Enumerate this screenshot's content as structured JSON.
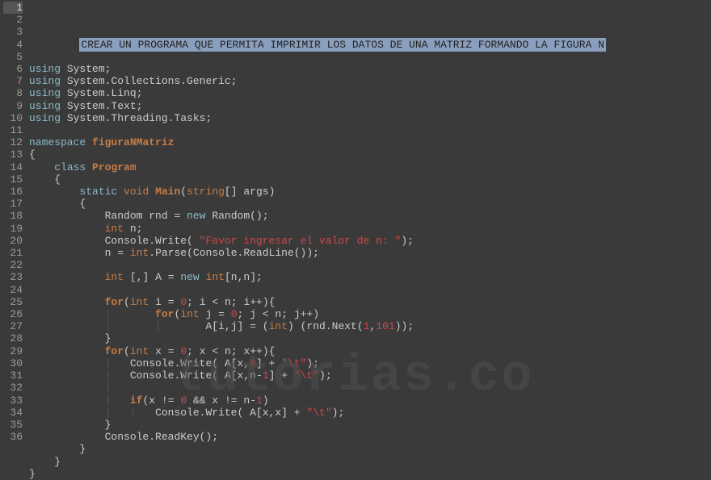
{
  "watermark": "tutorias.co",
  "lines": [
    {
      "n": 1,
      "current": true,
      "html": "        <span class='sel' data-name='selected-text' data-interactable='false'>CREAR UN PROGRAMA QUE PERMITA IMPRIMIR LOS DATOS DE UNA MATRIZ FORMANDO LA FIGURA N</span>"
    },
    {
      "n": 2,
      "html": ""
    },
    {
      "n": 3,
      "html": "<span class='kw-using'>using</span> <span class='id'>System</span><span class='punct'>;</span>"
    },
    {
      "n": 4,
      "html": "<span class='kw-using'>using</span> <span class='id'>System.Collections.Generic</span><span class='punct'>;</span>"
    },
    {
      "n": 5,
      "html": "<span class='kw-using'>using</span> <span class='id'>System.Linq</span><span class='punct'>;</span>"
    },
    {
      "n": 6,
      "html": "<span class='kw-using'>using</span> <span class='id'>System.Text</span><span class='punct'>;</span>"
    },
    {
      "n": 7,
      "html": "<span class='kw-using'>using</span> <span class='id'>System.Threading.Tasks</span><span class='punct'>;</span>"
    },
    {
      "n": 8,
      "html": ""
    },
    {
      "n": 9,
      "html": "<span class='kw-namespace'>namespace</span> <span class='namespace-name'>figuraNMatriz</span>"
    },
    {
      "n": 10,
      "html": "<span class='brace'>{</span>"
    },
    {
      "n": 11,
      "html": "    <span class='kw-class'>class</span> <span class='class-name'>Program</span>"
    },
    {
      "n": 12,
      "html": "    <span class='brace'>{</span>"
    },
    {
      "n": 13,
      "html": "        <span class='kw-static'>static</span> <span class='kw-void'>void</span> <span class='method'>Main</span><span class='paren'>(</span><span class='type-string'>string</span><span class='punct'>[]</span> <span class='id'>args</span><span class='paren'>)</span>"
    },
    {
      "n": 14,
      "html": "        <span class='brace'>{</span>"
    },
    {
      "n": 15,
      "html": "            <span class='id'>Random</span> <span class='id'>rnd</span> <span class='op'>=</span> <span class='kw-new'>new</span> <span class='id'>Random</span><span class='paren'>()</span><span class='punct'>;</span>"
    },
    {
      "n": 16,
      "html": "            <span class='type-int'>int</span> <span class='id'>n</span><span class='punct'>;</span>"
    },
    {
      "n": 17,
      "html": "            <span class='id'>Console.Write</span><span class='paren'>(</span> <span class='str'>\"Favor ingresar el valor de n: \"</span><span class='paren'>)</span><span class='punct'>;</span>"
    },
    {
      "n": 18,
      "html": "            <span class='id'>n</span> <span class='op'>=</span> <span class='type-int'>int</span><span class='punct'>.</span><span class='id'>Parse</span><span class='paren'>(</span><span class='id'>Console.ReadLine</span><span class='paren'>())</span><span class='punct'>;</span>"
    },
    {
      "n": 19,
      "html": ""
    },
    {
      "n": 20,
      "html": "            <span class='type-int'>int</span> <span class='punct'>[,]</span> <span class='id'>A</span> <span class='op'>=</span> <span class='kw-new'>new</span> <span class='type-int'>int</span><span class='punct'>[</span><span class='id'>n</span><span class='punct'>,</span><span class='id'>n</span><span class='punct'>];</span>"
    },
    {
      "n": 21,
      "html": ""
    },
    {
      "n": 22,
      "html": "            <span class='kw-for'>for</span><span class='paren'>(</span><span class='type-int'>int</span> <span class='id'>i</span> <span class='op'>=</span> <span class='num'>0</span><span class='punct'>;</span> <span class='id'>i</span> <span class='op'>&lt;</span> <span class='id'>n</span><span class='punct'>;</span> <span class='id'>i++</span><span class='paren'>)</span><span class='brace'>{</span>"
    },
    {
      "n": 23,
      "html": "            <span class='indent-guide'>|</span>       <span class='kw-for'>for</span><span class='paren'>(</span><span class='type-int'>int</span> <span class='id'>j</span> <span class='op'>=</span> <span class='num'>0</span><span class='punct'>;</span> <span class='id'>j</span> <span class='op'>&lt;</span> <span class='id'>n</span><span class='punct'>;</span> <span class='id'>j++</span><span class='paren'>)</span>"
    },
    {
      "n": 24,
      "html": "            <span class='indent-guide'>|</span>       <span class='indent-guide'>|</span>       <span class='id'>A</span><span class='punct'>[</span><span class='id'>i</span><span class='punct'>,</span><span class='id'>j</span><span class='punct'>]</span> <span class='op'>=</span> <span class='paren'>(</span><span class='type-int'>int</span><span class='paren'>)</span> <span class='paren'>(</span><span class='id'>rnd.Next</span><span class='paren'>(</span><span class='num'>1</span><span class='punct'>,</span><span class='num'>101</span><span class='paren'>))</span><span class='punct'>;</span>"
    },
    {
      "n": 25,
      "html": "            <span class='brace'>}</span>"
    },
    {
      "n": 26,
      "html": "            <span class='kw-for'>for</span><span class='paren'>(</span><span class='type-int'>int</span> <span class='id'>x</span> <span class='op'>=</span> <span class='num'>0</span><span class='punct'>;</span> <span class='id'>x</span> <span class='op'>&lt;</span> <span class='id'>n</span><span class='punct'>;</span> <span class='id'>x++</span><span class='paren'>)</span><span class='brace'>{</span>"
    },
    {
      "n": 27,
      "html": "            <span class='indent-guide'>|</span>   <span class='id'>Console.Write</span><span class='paren'>(</span> <span class='id'>A</span><span class='punct'>[</span><span class='id'>x</span><span class='punct'>,</span><span class='num'>0</span><span class='punct'>]</span> <span class='op'>+</span> <span class='str'>\"\\t\"</span><span class='paren'>)</span><span class='punct'>;</span>"
    },
    {
      "n": 28,
      "html": "            <span class='indent-guide'>|</span>   <span class='id'>Console.Write</span><span class='paren'>(</span> <span class='id'>A</span><span class='punct'>[</span><span class='id'>x</span><span class='punct'>,</span><span class='id'>n</span><span class='op'>-</span><span class='num'>1</span><span class='punct'>]</span> <span class='op'>+</span> <span class='str'>\"\\t\"</span><span class='paren'>)</span><span class='punct'>;</span>"
    },
    {
      "n": 29,
      "html": "            <span class='indent-guide'>|</span>"
    },
    {
      "n": 30,
      "html": "            <span class='indent-guide'>|</span>   <span class='kw-if'>if</span><span class='paren'>(</span><span class='id'>x</span> <span class='op'>!=</span> <span class='num'>0</span> <span class='op'>&amp;&amp;</span> <span class='id'>x</span> <span class='op'>!=</span> <span class='id'>n</span><span class='op'>-</span><span class='num'>1</span><span class='paren'>)</span>"
    },
    {
      "n": 31,
      "html": "            <span class='indent-guide'>|</span>   <span class='indent-guide'>|</span>   <span class='id'>Console.Write</span><span class='paren'>(</span> <span class='id'>A</span><span class='punct'>[</span><span class='id'>x</span><span class='punct'>,</span><span class='id'>x</span><span class='punct'>]</span> <span class='op'>+</span> <span class='str'>\"\\t\"</span><span class='paren'>)</span><span class='punct'>;</span>"
    },
    {
      "n": 32,
      "html": "            <span class='brace'>}</span>"
    },
    {
      "n": 33,
      "html": "            <span class='id'>Console.ReadKey</span><span class='paren'>()</span><span class='punct'>;</span>"
    },
    {
      "n": 34,
      "html": "        <span class='brace'>}</span>"
    },
    {
      "n": 35,
      "html": "    <span class='brace'>}</span>"
    },
    {
      "n": 36,
      "html": "<span class='brace'>}</span>"
    }
  ]
}
